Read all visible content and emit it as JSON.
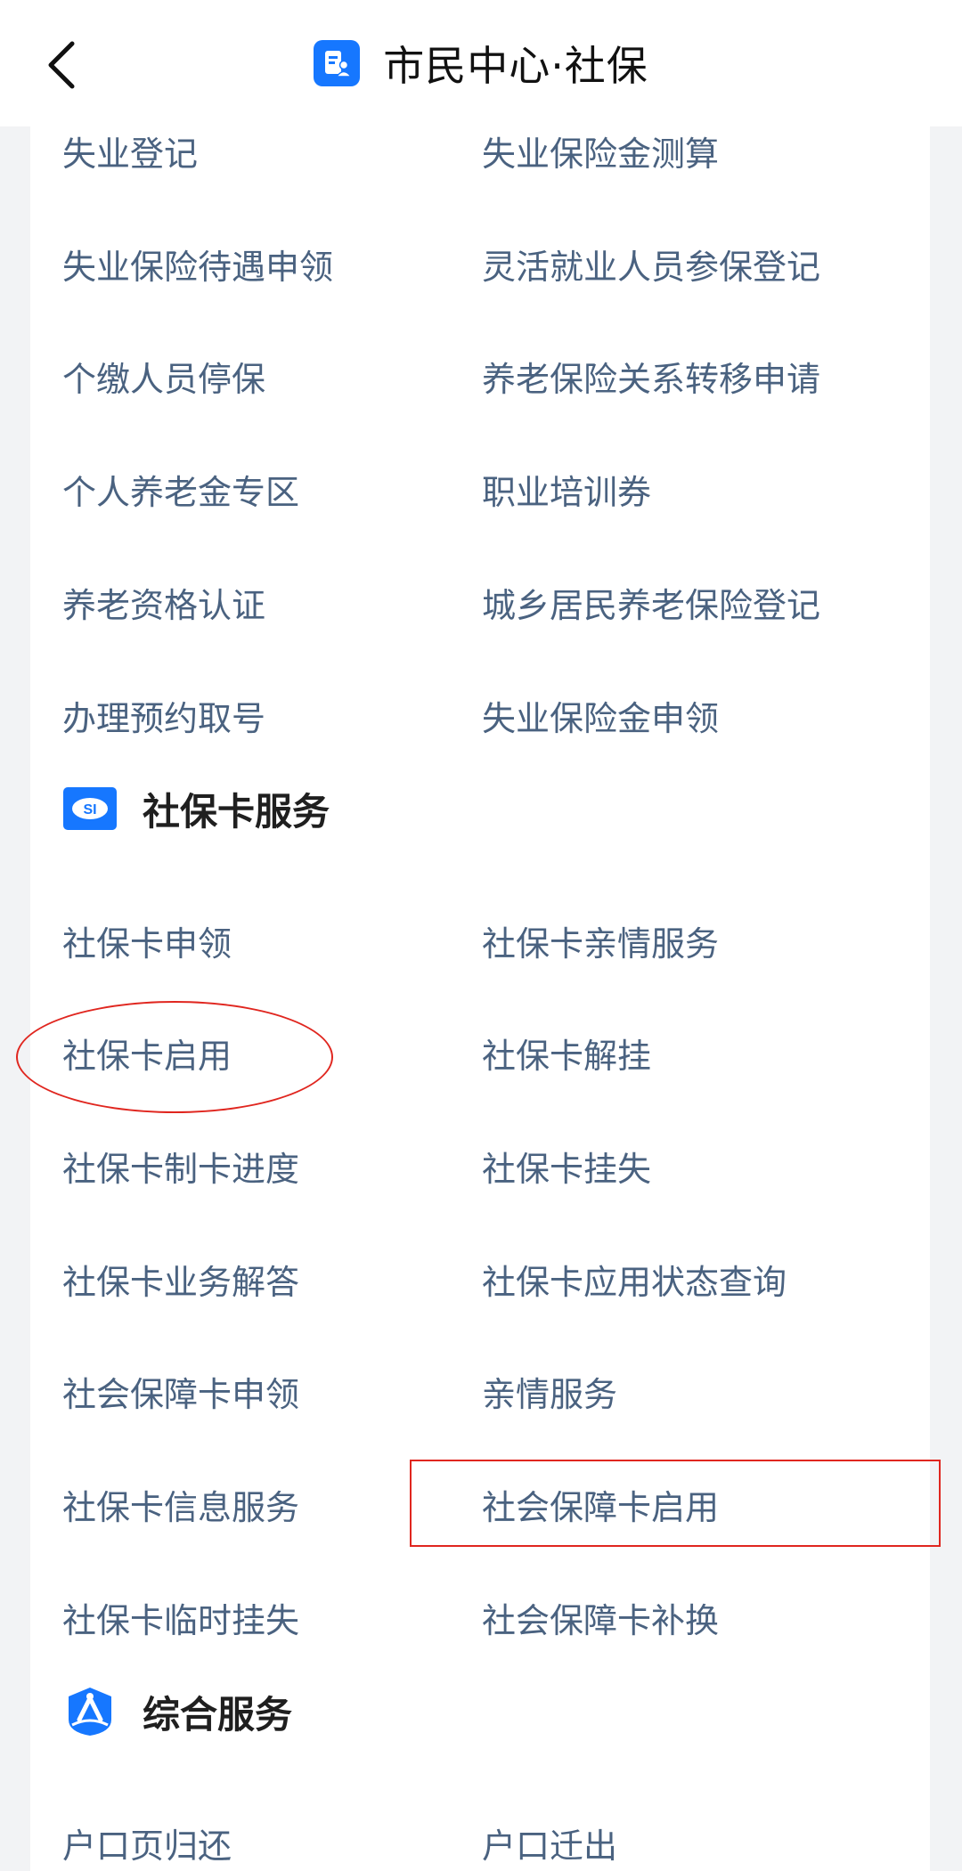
{
  "header": {
    "title": "市民中心·社保"
  },
  "icons": {
    "back": "chevron-left-icon",
    "app": "document-person-icon",
    "social_card": "social-security-card-icon",
    "comprehensive": "person-badge-icon"
  },
  "accent_color": "#1677ff",
  "annotation_color": "#e0261f",
  "top_items": [
    [
      "失业登记",
      "失业保险金测算"
    ],
    [
      "失业保险待遇申领",
      "灵活就业人员参保登记"
    ],
    [
      "个缴人员停保",
      "养老保险关系转移申请"
    ],
    [
      "个人养老金专区",
      "职业培训券"
    ],
    [
      "养老资格认证",
      "城乡居民养老保险登记"
    ],
    [
      "办理预约取号",
      "失业保险金申领"
    ]
  ],
  "social_card": {
    "title": "社保卡服务",
    "items": [
      [
        "社保卡申领",
        "社保卡亲情服务"
      ],
      [
        "社保卡启用",
        "社保卡解挂"
      ],
      [
        "社保卡制卡进度",
        "社保卡挂失"
      ],
      [
        "社保卡业务解答",
        "社保卡应用状态查询"
      ],
      [
        "社会保障卡申领",
        "亲情服务"
      ],
      [
        "社保卡信息服务",
        "社会保障卡启用"
      ],
      [
        "社保卡临时挂失",
        "社会保障卡补换"
      ]
    ]
  },
  "comprehensive": {
    "title": "综合服务",
    "items": [
      [
        "户口页归还",
        "户口迁出"
      ]
    ]
  }
}
